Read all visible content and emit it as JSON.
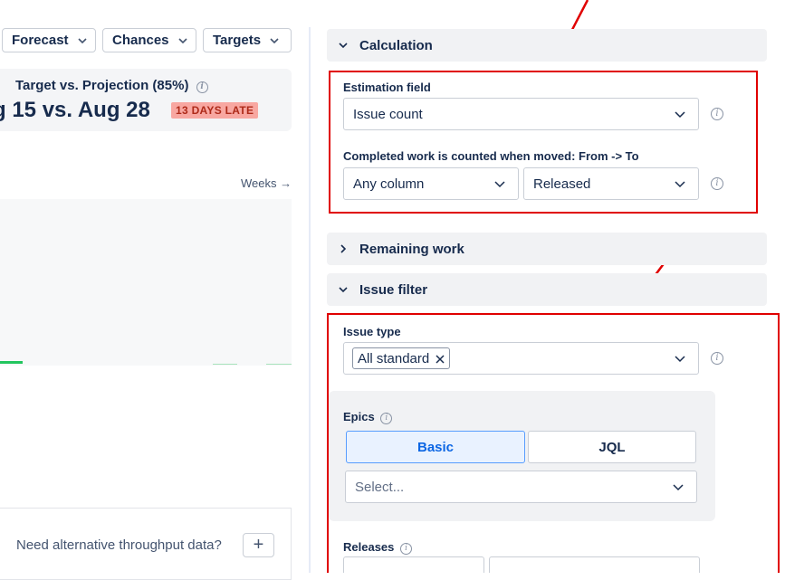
{
  "toolbar": {
    "forecast_label": "Forecast",
    "chances_label": "Chances",
    "targets_label": "Targets"
  },
  "summary": {
    "title": "Target vs. Projection (85%)",
    "main": "g 15 vs. Aug 28",
    "badge": "13 DAYS LATE"
  },
  "chart": {
    "weeks_link": "Weeks →",
    "accent_color": "#22c55e"
  },
  "throughput": {
    "prompt": "Need alternative throughput data?",
    "add_label": "+"
  },
  "calculation": {
    "header": "Calculation",
    "estimation_label": "Estimation field",
    "estimation_value": "Issue count",
    "completed_label": "Completed work is counted when moved: From -> To",
    "from_value": "Any column",
    "to_value": "Released"
  },
  "remaining_work": {
    "header": "Remaining work"
  },
  "issue_filter": {
    "header": "Issue filter",
    "issue_type_label": "Issue type",
    "issue_type_tag": "All standard",
    "epics_label": "Epics",
    "basic_label": "Basic",
    "jql_label": "JQL",
    "epics_placeholder": "Select...",
    "releases_label": "Releases"
  },
  "colors": {
    "highlight_box": "#e00000",
    "late_badge_bg": "#f8a7a1",
    "late_badge_text": "#ae2a19",
    "selected_segment": "#0c66e4"
  }
}
